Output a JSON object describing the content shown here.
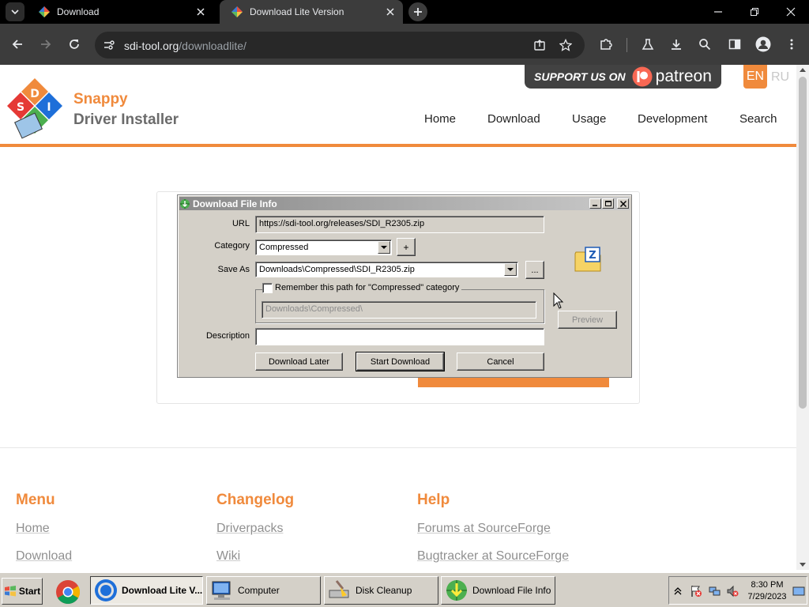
{
  "browser": {
    "tabs": [
      {
        "title": "Download",
        "active": false
      },
      {
        "title": "Download Lite Version",
        "active": true
      }
    ],
    "address": {
      "host": "sdi-tool.org",
      "path": "/downloadlite/"
    }
  },
  "site": {
    "brand_line1": "Snappy",
    "brand_line2": "Driver Installer",
    "support_label": "SUPPORT US ON",
    "patreon_label": "patreon",
    "lang_en": "EN",
    "lang_ru": "RU",
    "nav": [
      "Home",
      "Download",
      "Usage",
      "Development",
      "Search"
    ],
    "footer": {
      "menu_title": "Menu",
      "menu_links": [
        "Home",
        "Download"
      ],
      "changelog_title": "Changelog",
      "changelog_links": [
        "Driverpacks",
        "Wiki"
      ],
      "help_title": "Help",
      "help_links": [
        "Forums at SourceForge",
        "Bugtracker at SourceForge"
      ]
    }
  },
  "dialog": {
    "title": "Download File Info",
    "url_label": "URL",
    "url_value": "https://sdi-tool.org/releases/SDI_R2305.zip",
    "category_label": "Category",
    "category_value": "Compressed",
    "add_category": "+",
    "save_as_label": "Save As",
    "save_as_value": "Downloads\\Compressed\\SDI_R2305.zip",
    "browse": "...",
    "remember_label": "Remember this path for \"Compressed\" category",
    "remember_checked": false,
    "remember_path": "Downloads\\Compressed\\",
    "preview": "Preview",
    "description_label": "Description",
    "description_value": "",
    "download_later": "Download Later",
    "start_download": "Start Download",
    "cancel": "Cancel"
  },
  "taskbar": {
    "start": "Start",
    "buttons": [
      "Download Lite V...",
      "Computer",
      "Disk Cleanup",
      "Download File Info"
    ],
    "time": "8:30 PM",
    "date": "7/29/2023"
  },
  "colors": {
    "accent": "#f08a3c",
    "patreon": "#f96854"
  }
}
